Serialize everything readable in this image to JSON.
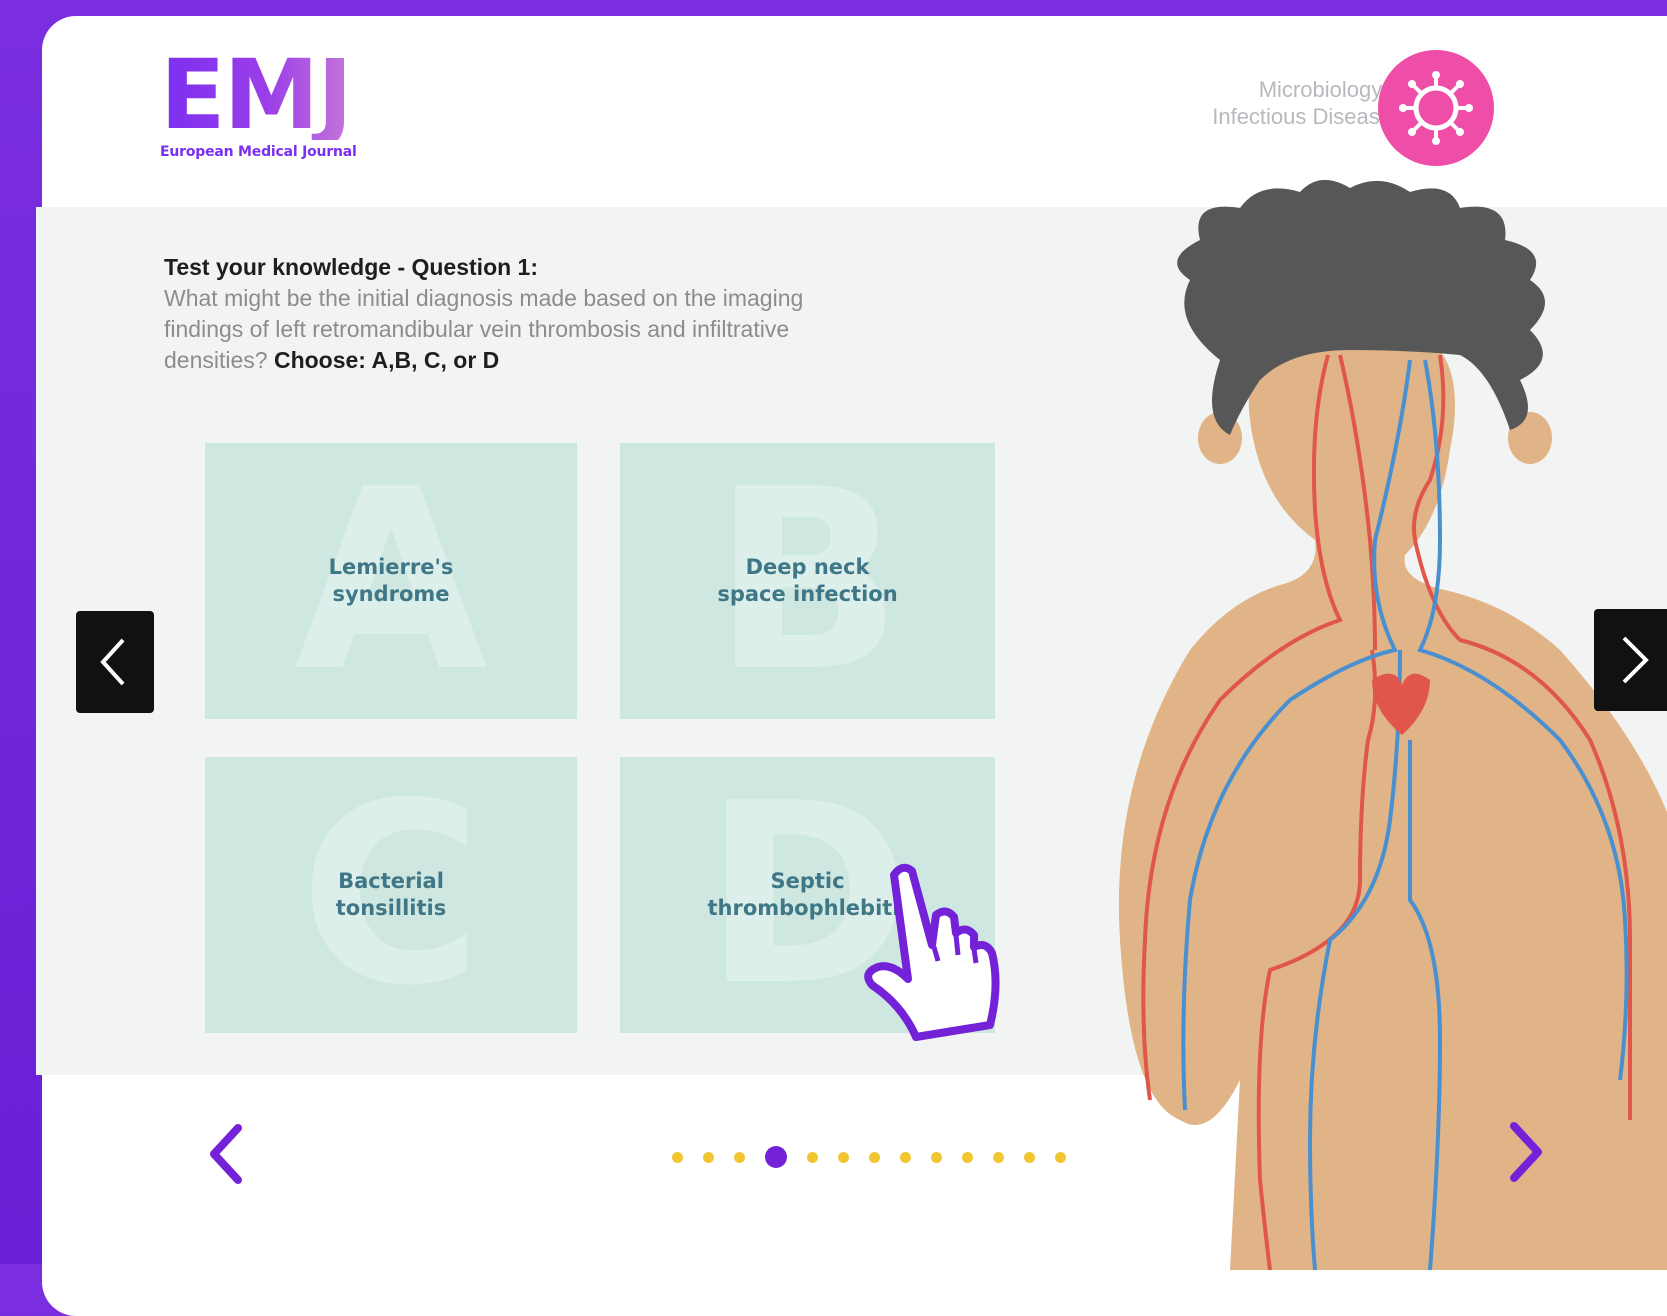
{
  "logo": {
    "main": "EMJ",
    "sub": "European Medical Journal"
  },
  "header": {
    "category_line1": "Microbiology &",
    "category_line2": "Infectious Diseases",
    "category_icon": "virus-icon",
    "category_color": "#ee4ea8"
  },
  "question": {
    "title": "Test your knowledge - Question 1:",
    "text": "What might be the initial diagnosis made based on the imaging findings of left retromandibular vein thrombosis and infiltrative densities?",
    "instruction": "Choose: A,B, C, or D"
  },
  "options": [
    {
      "letter": "A",
      "line1": "Lemierre's",
      "line2": "syndrome"
    },
    {
      "letter": "B",
      "line1": "Deep neck",
      "line2": "space infection"
    },
    {
      "letter": "C",
      "line1": "Bacterial",
      "line2": "tonsillitis"
    },
    {
      "letter": "D",
      "line1": "Septic",
      "line2": "thrombophlebitis"
    }
  ],
  "pagination": {
    "total": 13,
    "current": 4
  },
  "colors": {
    "accent": "#7422d8",
    "option_bg": "#cfe7e1",
    "option_text": "#3f7787",
    "dot": "#f2c533"
  },
  "icons": {
    "prev": "chevron-left-icon",
    "next": "chevron-right-icon",
    "cursor": "pointing-hand-icon",
    "figure": "circulatory-system-illustration"
  }
}
